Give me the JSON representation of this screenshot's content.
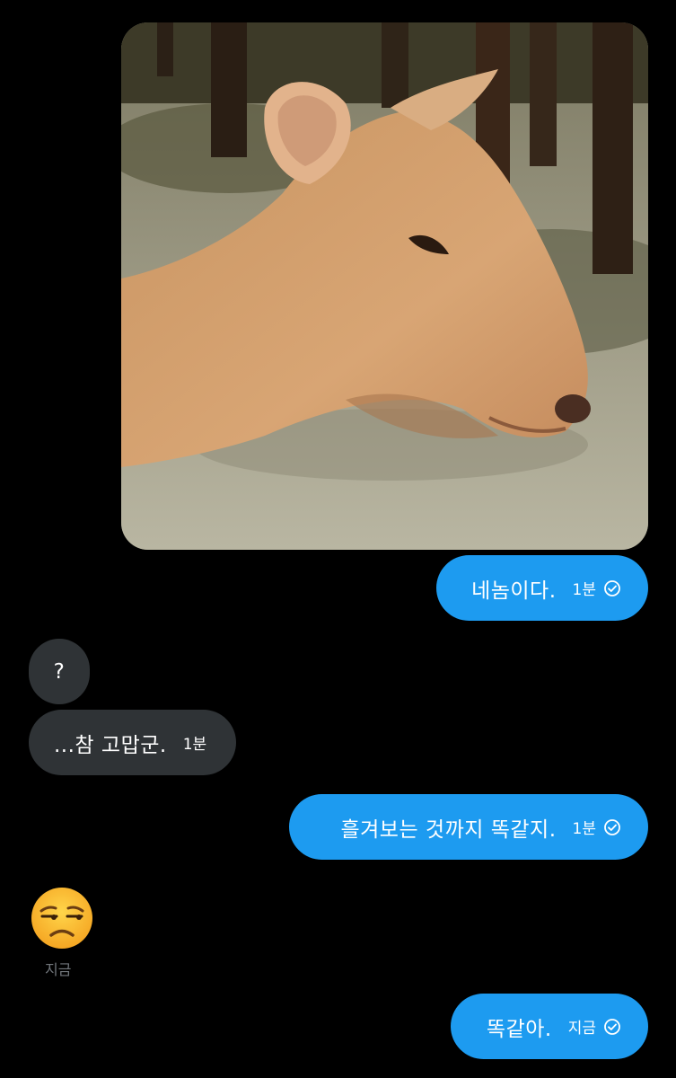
{
  "conversation": {
    "photo": {
      "alt": "deer"
    },
    "messages": [
      {
        "sender": "me",
        "text": "네놈이다.",
        "time": "1분",
        "status": "check-circle-icon"
      },
      {
        "sender": "other",
        "text": "?"
      },
      {
        "sender": "other",
        "text": "...참 고맙군.",
        "time": "1분"
      },
      {
        "sender": "me",
        "text": "흘겨보는 것까지 똑같지.",
        "time": "1분",
        "status": "check-circle-icon"
      },
      {
        "sender": "other",
        "emoji": "unamused-face-icon",
        "time": "지금"
      },
      {
        "sender": "me",
        "text": "똑같아.",
        "time": "지금",
        "status": "check-circle-icon"
      }
    ]
  },
  "colors": {
    "outgoing_bubble": "#1d9bf0",
    "incoming_bubble": "#2f3336",
    "background": "#000000",
    "muted_text": "#71767b"
  }
}
